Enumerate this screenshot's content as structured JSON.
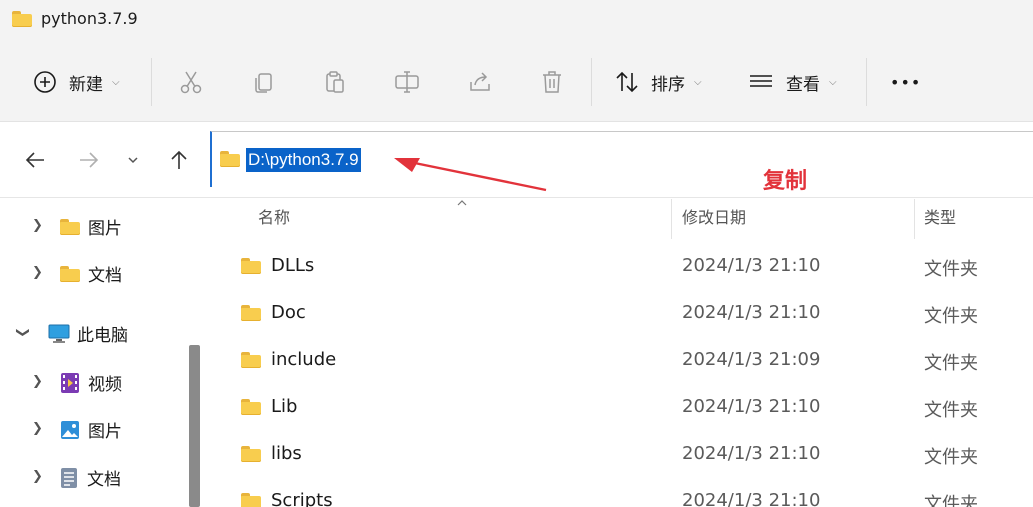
{
  "window": {
    "title": "python3.7.9"
  },
  "toolbar": {
    "new_label": "新建",
    "sort_label": "排序",
    "view_label": "查看",
    "more_label": "•••"
  },
  "address": {
    "path": "D:\\python3.7.9",
    "annotation": "复制"
  },
  "sidebar": {
    "items": [
      {
        "label": "图片"
      },
      {
        "label": "文档"
      },
      {
        "label": "此电脑"
      },
      {
        "label": "视频"
      },
      {
        "label": "图片"
      },
      {
        "label": "文档"
      }
    ]
  },
  "columns": {
    "name": "名称",
    "date": "修改日期",
    "type": "类型"
  },
  "files": [
    {
      "name": "DLLs",
      "date": "2024/1/3 21:10",
      "type": "文件夹"
    },
    {
      "name": "Doc",
      "date": "2024/1/3 21:10",
      "type": "文件夹"
    },
    {
      "name": "include",
      "date": "2024/1/3 21:09",
      "type": "文件夹"
    },
    {
      "name": "Lib",
      "date": "2024/1/3 21:10",
      "type": "文件夹"
    },
    {
      "name": "libs",
      "date": "2024/1/3 21:10",
      "type": "文件夹"
    },
    {
      "name": "Scripts",
      "date": "2024/1/3 21:10",
      "type": "文件夹"
    }
  ],
  "colors": {
    "accent": "#0a63c9",
    "annotation": "#e2333b",
    "folder": "#f8cd4e"
  }
}
